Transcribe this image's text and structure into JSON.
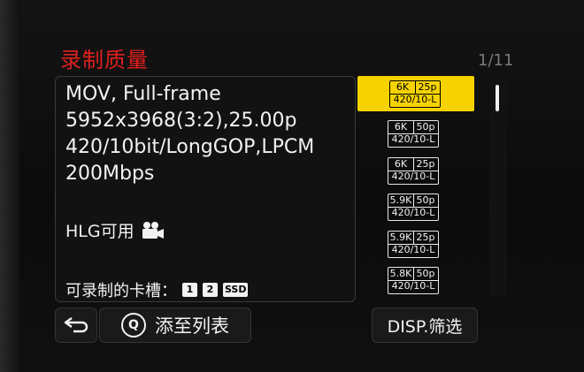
{
  "title": "录制质量",
  "page_indicator": "1/11",
  "info": {
    "format": "MOV, Full-frame",
    "resolution": "5952x3968(3:2),25.00p",
    "codec": "420/10bit/LongGOP,LPCM",
    "bitrate": "200Mbps",
    "hlg": "HLG可用",
    "slots_label": "可录制的卡槽：",
    "slots": [
      "1",
      "2",
      "SSD"
    ]
  },
  "items": [
    {
      "res": "6K",
      "fps": "25p",
      "fmt": "420/10-L",
      "selected": true
    },
    {
      "res": "6K",
      "fps": "50p",
      "fmt": "420/10-L"
    },
    {
      "res": "6K",
      "fps": "25p",
      "fmt": "420/10-L"
    },
    {
      "res": "5.9K",
      "fps": "50p",
      "fmt": "420/10-L"
    },
    {
      "res": "5.9K",
      "fps": "25p",
      "fmt": "420/10-L"
    },
    {
      "res": "5.8K",
      "fps": "50p",
      "fmt": "420/10-L"
    }
  ],
  "buttons": {
    "add_label": "添至列表",
    "q_label": "Q",
    "filter_label": "DISP.筛选"
  },
  "icons": {
    "back": "back-arrow-icon",
    "movie": "movie-camera-icon"
  }
}
